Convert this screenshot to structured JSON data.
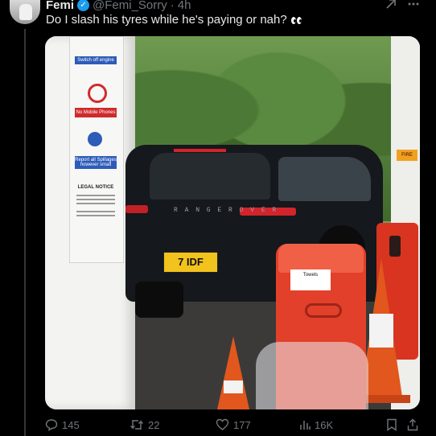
{
  "tweet": {
    "author_name": "Femi",
    "handle": "@Femi_Sorry",
    "separator": "·",
    "time": "4h",
    "text": "Do I slash his tyres while he's paying or nah?"
  },
  "image": {
    "sign_switch_off": "Switch off engine",
    "sign_no_phones": "No Mobile Phones",
    "sign_report": "Report all Spillages however small",
    "legal_notice": "LEGAL NOTICE",
    "car_badge": "R A N G E   R O V E R",
    "number_plate": "7 IDF",
    "bin_label": "Towels",
    "fire_label": "FIRE"
  },
  "actions": {
    "replies": "145",
    "reposts": "22",
    "likes": "177",
    "views": "16K"
  },
  "colors": {
    "background": "#000000",
    "verified": "#1d9bf0",
    "muted": "#71767b",
    "text": "#e7e9ea"
  }
}
